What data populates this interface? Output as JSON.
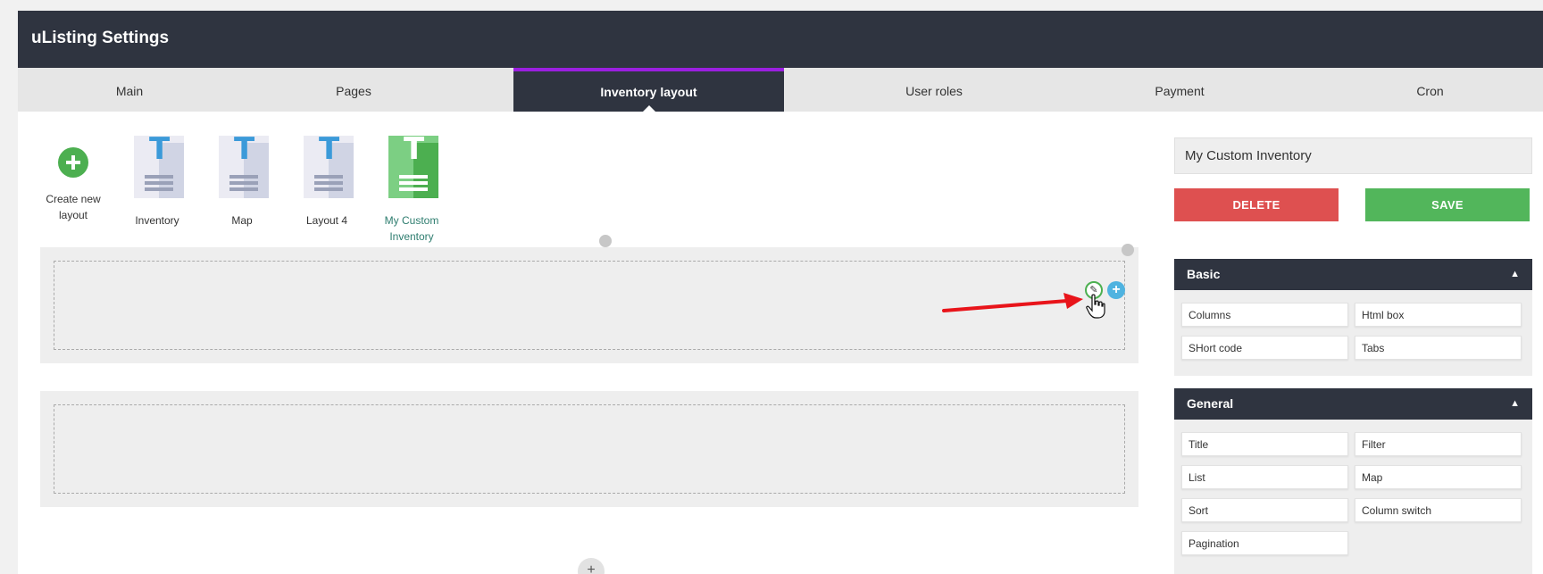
{
  "header": {
    "title": "uListing Settings"
  },
  "tabs": [
    {
      "label": "Main"
    },
    {
      "label": "Pages"
    },
    {
      "label": "Inventory layout",
      "active": true
    },
    {
      "label": "User roles"
    },
    {
      "label": "Payment"
    },
    {
      "label": "Cron"
    }
  ],
  "layouts": {
    "create_label": "Create new layout",
    "items": [
      {
        "label": "Inventory"
      },
      {
        "label": "Map"
      },
      {
        "label": "Layout 4"
      },
      {
        "label": "My Custom Inventory",
        "active": true
      }
    ]
  },
  "sidebar": {
    "layout_name": "My Custom Inventory",
    "delete_label": "DELETE",
    "save_label": "SAVE",
    "basic": {
      "title": "Basic",
      "items": [
        "Columns",
        "Html box",
        "SHort code",
        "Tabs"
      ]
    },
    "general": {
      "title": "General",
      "items": [
        "Title",
        "Filter",
        "List",
        "Map",
        "Sort",
        "Column switch",
        "Pagination"
      ]
    }
  },
  "canvas": {
    "add_row_symbol": "+"
  },
  "colors": {
    "header_bg": "#2f3440",
    "active_tab_border": "#9b1fe0",
    "green": "#4caf50",
    "red": "#de5050",
    "blue": "#4fb3e0"
  }
}
